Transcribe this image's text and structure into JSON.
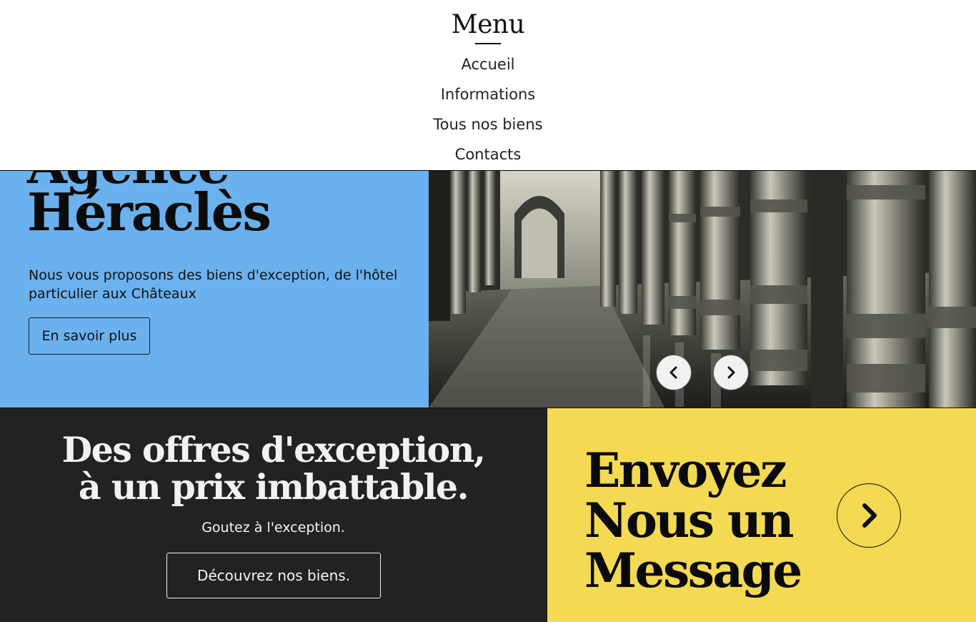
{
  "menu": {
    "title": "Menu",
    "items": [
      {
        "label": "Accueil"
      },
      {
        "label": "Informations"
      },
      {
        "label": "Tous nos biens"
      },
      {
        "label": "Contacts"
      }
    ]
  },
  "hero": {
    "title": "Agence\nHéraclès",
    "description": "Nous vous proposons des biens d'exception, de l'hôtel particulier aux Châteaux",
    "button_label": "En savoir plus",
    "background_color": "#6ab1ee",
    "carousel": {
      "prev_icon": "chevron-left-icon",
      "next_icon": "chevron-right-icon"
    }
  },
  "offers": {
    "heading": "Des offres d'exception,\nà un prix imbattable.",
    "subtitle": "Goutez à l'exception.",
    "button_label": "Découvrez nos biens.",
    "background_color": "#222222"
  },
  "message": {
    "heading": "Envoyez\nNous un\nMessage",
    "icon": "chevron-right-icon",
    "background_color": "#f4d953"
  }
}
